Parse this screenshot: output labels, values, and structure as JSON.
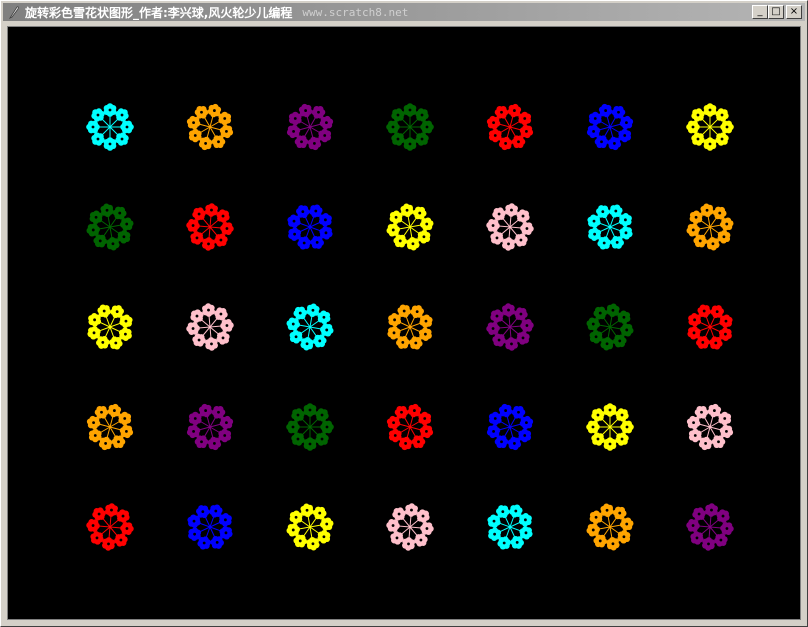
{
  "window": {
    "title": "旋转彩色雪花状图形_作者:李兴球,风火轮少儿编程",
    "url": "www.scratch8.net",
    "controls": {
      "minimize": "_",
      "maximize": "□",
      "close": "×"
    }
  },
  "canvas": {
    "background": "#000000",
    "grid": [
      [
        "#00ffff",
        "#ffa500",
        "#800080",
        "#006400",
        "#ff0000",
        "#0000ff",
        "#ffff00"
      ],
      [
        "#006400",
        "#ff0000",
        "#0000ff",
        "#ffff00",
        "#ffc0cb",
        "#00ffff",
        "#ffa500"
      ],
      [
        "#ffff00",
        "#ffc0cb",
        "#00ffff",
        "#ffa500",
        "#800080",
        "#006400",
        "#ff0000"
      ],
      [
        "#ffa500",
        "#800080",
        "#006400",
        "#ff0000",
        "#0000ff",
        "#ffff00",
        "#ffc0cb"
      ],
      [
        "#ff0000",
        "#0000ff",
        "#ffff00",
        "#ffc0cb",
        "#00ffff",
        "#ffa500",
        "#800080"
      ]
    ]
  }
}
